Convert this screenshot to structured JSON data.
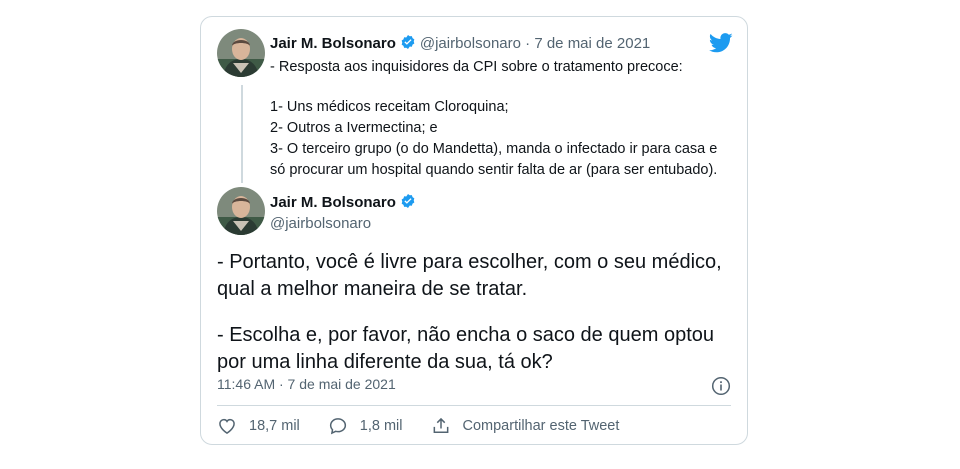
{
  "parent": {
    "name": "Jair M. Bolsonaro",
    "handle": "@jairbolsonaro",
    "separator": "·",
    "date": "7 de mai de 2021",
    "lines": [
      "- Resposta aos inquisidores da CPI sobre o tratamento precoce:",
      "1- Uns médicos receitam Cloroquina;",
      "2- Outros a Ivermectina; e",
      "3- O terceiro grupo (o do Mandetta), manda o infectado ir para casa e",
      "só procurar um hospital quando sentir falta de ar (para ser entubado)."
    ]
  },
  "tweet": {
    "name": "Jair M. Bolsonaro",
    "handle": "@jairbolsonaro",
    "lines": [
      "- Portanto, você é livre para escolher, com o seu médico,",
      "qual a melhor maneira de se tratar.",
      "- Escolha e, por favor, não encha o saco de quem optou",
      "por uma linha diferente da sua, tá ok?"
    ],
    "timestamp": "11:46 AM · 7 de mai de 2021"
  },
  "actions": {
    "likes": "18,7 mil",
    "replies": "1,8 mil",
    "share_label": "Compartilhar este Tweet"
  },
  "icons": {
    "logo": "twitter-bird-icon",
    "verified": "verified-badge-icon",
    "info": "info-icon",
    "like": "heart-icon",
    "reply": "reply-icon",
    "share": "share-icon"
  },
  "colors": {
    "brand": "#1d9bf0",
    "text": "#0f1419",
    "secondary": "#536471",
    "border": "#cfd9de"
  }
}
